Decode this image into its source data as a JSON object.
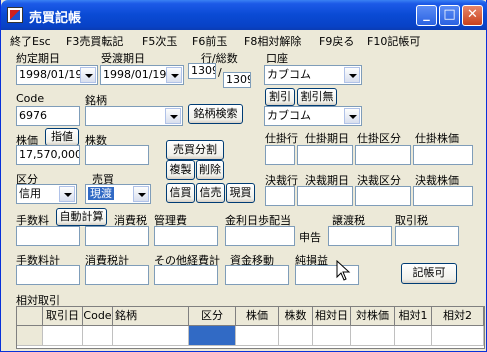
{
  "window": {
    "title": "売買記帳"
  },
  "menu": [
    "終了Esc",
    "F3売買転記",
    "F5次玉",
    "F6前玉",
    "F8相対解除",
    "F9戻る",
    "F10記帳可"
  ],
  "form": {
    "contract_date_label": "約定期日",
    "contract_date": "1998/01/19",
    "delivery_date_label": "受渡期日",
    "delivery_date": "1998/01/19",
    "row_total_label": "行/総数",
    "row_value": "1309",
    "total_value": "1309",
    "account_label": "口座",
    "account": "カブコム",
    "code_label": "Code",
    "code": "6976",
    "stock_label": "銘柄",
    "stock": "",
    "stock_search_button": "銘柄検索",
    "discount_button": "割引",
    "no_discount_button": "割引無",
    "broker": "カブコム",
    "price_label": "株価",
    "limit_button": "指値",
    "shares_label": "株数",
    "price": "17,570,000",
    "shares": "",
    "split_button": "売買分割",
    "copy_button": "複製",
    "delete_button": "削除",
    "category_label": "区分",
    "category": "信用",
    "trade_label": "売買",
    "trade": "現渡",
    "credit_buy_button": "信買",
    "credit_sell_button": "信売",
    "spot_buy_button": "現買"
  },
  "pending": {
    "row": "仕掛行",
    "date": "仕掛期日",
    "cat": "仕掛区分",
    "price": "仕掛株価"
  },
  "settle": {
    "row": "決裁行",
    "date": "決裁期日",
    "cat": "決裁区分",
    "price": "決裁株価"
  },
  "fees": {
    "commission": "手数料",
    "auto_calc_button": "自動計算",
    "consumption_tax": "消費税",
    "mgmt_fee": "管理費",
    "interest": "金利日歩配当",
    "declare": "申告",
    "transfer_tax": "譲渡税",
    "trade_tax": "取引税",
    "commission_total": "手数料計",
    "consumption_total": "消費税計",
    "other_total": "その他経費計",
    "fund_move": "資金移動",
    "net_pl": "純損益",
    "record_button": "記帳可"
  },
  "relative": {
    "section_label": "相対取引",
    "columns": [
      "",
      "取引日",
      "Code",
      "銘柄",
      "区分",
      "株価",
      "株数",
      "相対日",
      "対株価",
      "相対1",
      "相対2"
    ]
  }
}
